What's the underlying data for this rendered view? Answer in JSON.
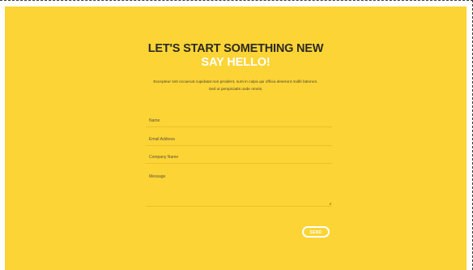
{
  "hero": {
    "heading": "LET'S START SOMETHING NEW",
    "subheading": "SAY HELLO!",
    "intro": "Excepteur sint occaecat cupidatat non proident, sunt in culpa qui officia deserunt mollit laborum. Sed ut perspiciatis unde omnis."
  },
  "form": {
    "name_label": "Name",
    "email_label": "Email Address",
    "company_label": "Company Name",
    "message_label": "Message",
    "send_label": "SEND"
  },
  "colors": {
    "background": "#fcd435",
    "heading": "#2c2a24",
    "accent": "#ffffff"
  }
}
